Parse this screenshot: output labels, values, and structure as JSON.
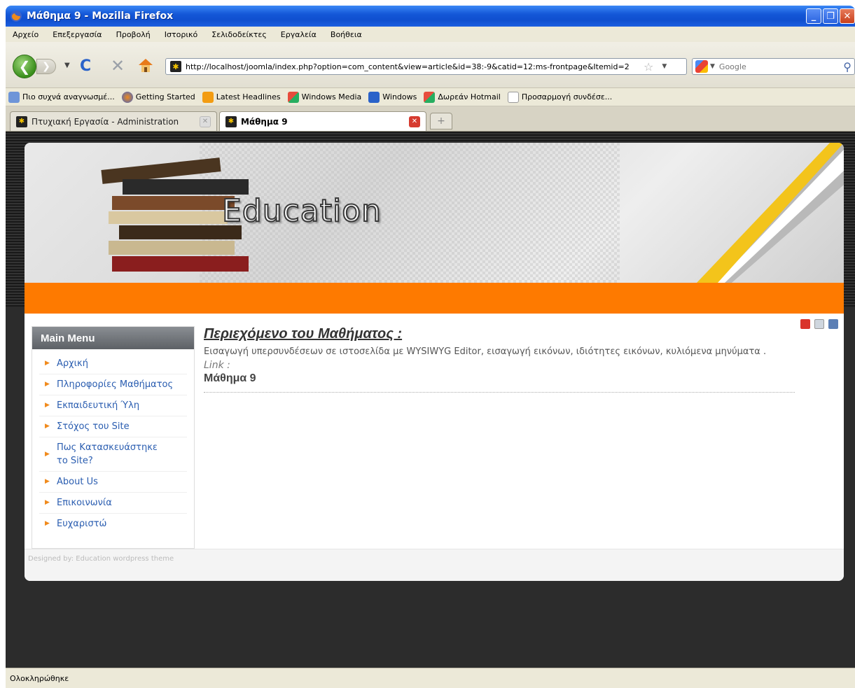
{
  "window": {
    "title": "Μάθημα 9 - Mozilla Firefox"
  },
  "menubar": {
    "items": [
      "Αρχείο",
      "Επεξεργασία",
      "Προβολή",
      "Ιστορικό",
      "Σελιδοδείκτες",
      "Εργαλεία",
      "Βοήθεια"
    ]
  },
  "navbar": {
    "url": "http://localhost/joomla/index.php?option=com_content&view=article&id=38:-9&catid=12:ms-frontpage&Itemid=2",
    "search_placeholder": "Google"
  },
  "bookmarks": {
    "items": [
      "Πιο συχνά αναγνωσμέ...",
      "Getting Started",
      "Latest Headlines",
      "Windows Media",
      "Windows",
      "Δωρεάν Hotmail",
      "Προσαρμογή συνδέσε..."
    ]
  },
  "tabs": [
    {
      "label": "Πτυχιακή Εργασία - Administration"
    },
    {
      "label": "Μάθημα 9"
    }
  ],
  "header": {
    "title": "Education"
  },
  "sidebar": {
    "heading": "Main Menu",
    "items": [
      {
        "label": "Αρχική"
      },
      {
        "label": "Πληροφορίες Μαθήματος"
      },
      {
        "label": "Εκπαιδευτική Ύλη"
      },
      {
        "label": "Στόχος του Site"
      },
      {
        "label": "Πως Κατασκευάστηκε το Site?"
      },
      {
        "label": "About Us"
      },
      {
        "label": "Επικοινωνία"
      },
      {
        "label": "Ευχαριστώ"
      }
    ]
  },
  "article": {
    "title": "Περιεχόμενο του Μαθήματος :",
    "body": "Εισαγωγή υπερσυνδέσεων σε ιστοσελίδα με WYSIWYG Editor, εισαγωγή εικόνων, ιδιότητες εικόνων, κυλιόμενα μηνύματα .",
    "link_label": "Link :",
    "lesson": "Μάθημα 9"
  },
  "footer": {
    "credit": "Designed by: Education wordpress theme"
  },
  "statusbar": {
    "text": "Ολοκληρώθηκε"
  },
  "colors": {
    "accent_orange": "#fe7a00",
    "menu_link": "#2a5db0",
    "titlebar_blue": "#1458d8"
  }
}
